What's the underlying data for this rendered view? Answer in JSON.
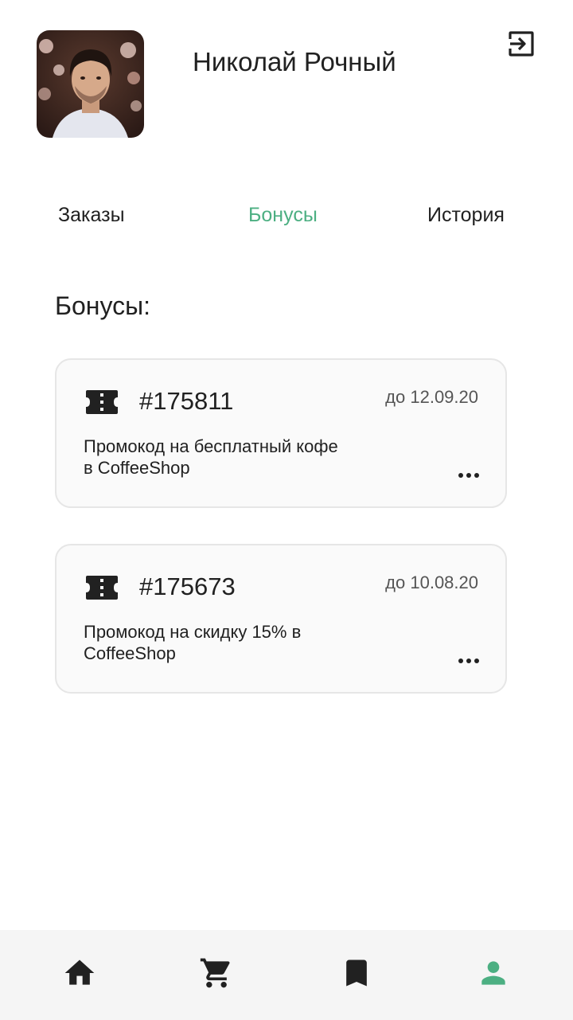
{
  "profile": {
    "name": "Николай Рочный"
  },
  "tabs": [
    {
      "label": "Заказы",
      "active": false
    },
    {
      "label": "Бонусы",
      "active": true
    },
    {
      "label": "История",
      "active": false
    }
  ],
  "bonuses": {
    "title": "Бонусы:",
    "items": [
      {
        "code": "#175811",
        "expires": "до 12.09.20",
        "description": "Промокод на бесплатный кофе в CoffeeShop",
        "icon": "ticket-icon"
      },
      {
        "code": "#175673",
        "expires": "до 10.08.20",
        "description": "Промокод на скидку 15% в CoffeeShop",
        "icon": "ticket-icon"
      }
    ]
  },
  "bottom_nav": {
    "items": [
      {
        "icon": "home-icon",
        "active": false
      },
      {
        "icon": "cart-icon",
        "active": false
      },
      {
        "icon": "bookmark-icon",
        "active": false
      },
      {
        "icon": "person-icon",
        "active": true
      }
    ]
  },
  "colors": {
    "accent": "#4caf82",
    "text": "#212121",
    "card_bg": "#fafafa",
    "card_border": "#e6e6e6",
    "nav_bg": "#f5f5f5"
  }
}
